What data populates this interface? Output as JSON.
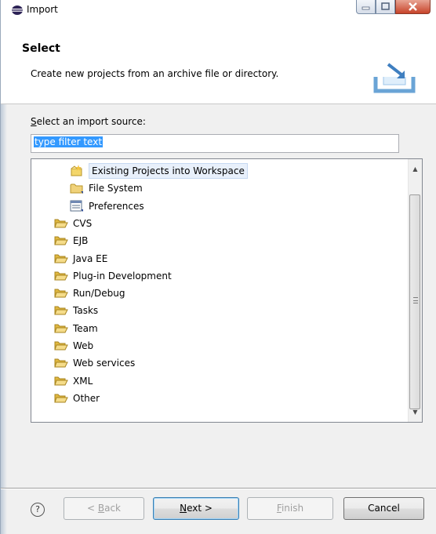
{
  "window": {
    "title": "Import"
  },
  "banner": {
    "title": "Select",
    "description": "Create new projects from an archive file or directory."
  },
  "source": {
    "label_prefix": "S",
    "label_rest": "elect an import source:",
    "filter_value": "type filter text"
  },
  "tree": {
    "items": [
      {
        "label": "Existing Projects into Workspace",
        "icon": "project-wizard-icon",
        "level": 2,
        "selected": true
      },
      {
        "label": "File System",
        "icon": "folder-icon",
        "level": 2
      },
      {
        "label": "Preferences",
        "icon": "preferences-icon",
        "level": 2
      },
      {
        "label": "CVS",
        "icon": "folder-open-icon",
        "level": 1
      },
      {
        "label": "EJB",
        "icon": "folder-open-icon",
        "level": 1
      },
      {
        "label": "Java EE",
        "icon": "folder-open-icon",
        "level": 1
      },
      {
        "label": "Plug-in Development",
        "icon": "folder-open-icon",
        "level": 1
      },
      {
        "label": "Run/Debug",
        "icon": "folder-open-icon",
        "level": 1
      },
      {
        "label": "Tasks",
        "icon": "folder-open-icon",
        "level": 1
      },
      {
        "label": "Team",
        "icon": "folder-open-icon",
        "level": 1
      },
      {
        "label": "Web",
        "icon": "folder-open-icon",
        "level": 1
      },
      {
        "label": "Web services",
        "icon": "folder-open-icon",
        "level": 1
      },
      {
        "label": "XML",
        "icon": "folder-open-icon",
        "level": 1
      },
      {
        "label": "Other",
        "icon": "folder-open-icon",
        "level": 1
      }
    ]
  },
  "buttons": {
    "help": "?",
    "back_pre": "< ",
    "back_u": "B",
    "back_rest": "ack",
    "next_u": "N",
    "next_rest": "ext >",
    "finish_u": "F",
    "finish_rest": "inish",
    "cancel": "Cancel"
  },
  "colors": {
    "selection": "#3399ff",
    "folder": "#e8c34a",
    "close_button": "#c7442a"
  }
}
